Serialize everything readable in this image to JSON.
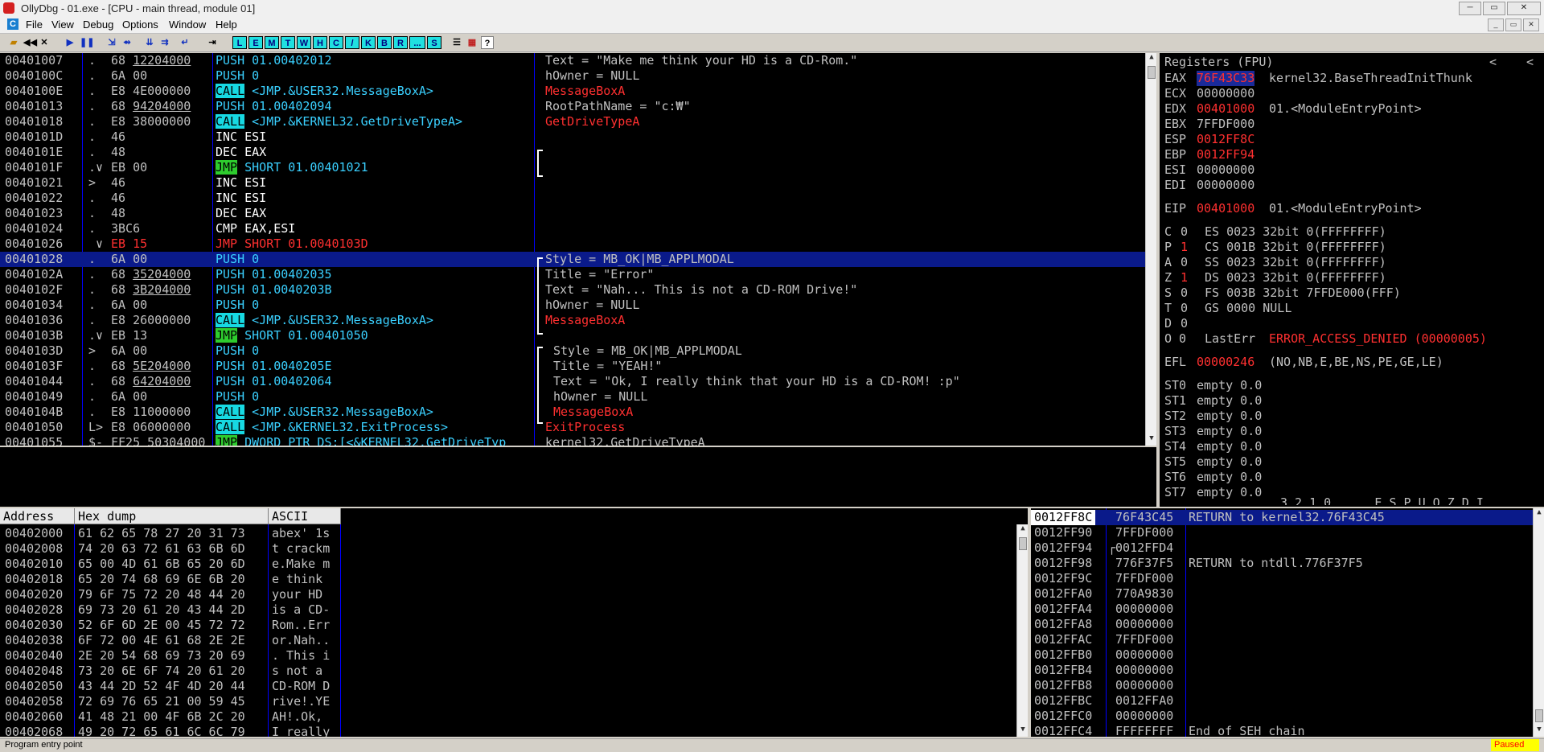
{
  "window": {
    "title": "OllyDbg - 01.exe - [CPU - main thread, module 01]",
    "min": "─",
    "max": "▭",
    "close": "✕"
  },
  "menu": [
    "File",
    "View",
    "Debug",
    "Options",
    "Window",
    "Help"
  ],
  "toolbar_letters": [
    "L",
    "E",
    "M",
    "T",
    "W",
    "H",
    "C",
    "/",
    "K",
    "B",
    "R",
    "...",
    "S"
  ],
  "disasm": [
    [
      "00401007",
      ".",
      "68 12204000",
      "PUSH 01.00402012",
      "Text = \"Make me think your HD is a CD-Rom.\""
    ],
    [
      "0040100C",
      ".",
      "6A 00",
      "PUSH 0",
      "hOwner = NULL"
    ],
    [
      "0040100E",
      ".",
      "E8 4E000000",
      "CALL <JMP.&USER32.MessageBoxA>",
      "MessageBoxA"
    ],
    [
      "00401013",
      ".",
      "68 94204000",
      "PUSH 01.00402094",
      "RootPathName = \"c:₩\""
    ],
    [
      "00401018",
      ".",
      "E8 38000000",
      "CALL <JMP.&KERNEL32.GetDriveTypeA>",
      "GetDriveTypeA"
    ],
    [
      "0040101D",
      ".",
      "46",
      "INC ESI",
      ""
    ],
    [
      "0040101E",
      ".",
      "48",
      "DEC EAX",
      ""
    ],
    [
      "0040101F",
      ".∨",
      "EB 00",
      "JMP SHORT 01.00401021",
      ""
    ],
    [
      "00401021",
      ">",
      "46",
      "INC ESI",
      ""
    ],
    [
      "00401022",
      ".",
      "46",
      "INC ESI",
      ""
    ],
    [
      "00401023",
      ".",
      "48",
      "DEC EAX",
      ""
    ],
    [
      "00401024",
      ".",
      "3BC6",
      "CMP EAX,ESI",
      ""
    ],
    [
      "00401026",
      " ∨",
      "EB 15",
      "JMP SHORT 01.0040103D",
      ""
    ],
    [
      "00401028",
      ".",
      "6A 00",
      "PUSH 0",
      "Style = MB_OK|MB_APPLMODAL"
    ],
    [
      "0040102A",
      ".",
      "68 35204000",
      "PUSH 01.00402035",
      "Title = \"Error\""
    ],
    [
      "0040102F",
      ".",
      "68 3B204000",
      "PUSH 01.0040203B",
      "Text = \"Nah... This is not a CD-ROM Drive!\""
    ],
    [
      "00401034",
      ".",
      "6A 00",
      "PUSH 0",
      "hOwner = NULL"
    ],
    [
      "00401036",
      ".",
      "E8 26000000",
      "CALL <JMP.&USER32.MessageBoxA>",
      "MessageBoxA"
    ],
    [
      "0040103B",
      ".∨",
      "EB 13",
      "JMP SHORT 01.00401050",
      ""
    ],
    [
      "0040103D",
      ">",
      "6A 00",
      "PUSH 0",
      "Style = MB_OK|MB_APPLMODAL"
    ],
    [
      "0040103F",
      ".",
      "68 5E204000",
      "PUSH 01.0040205E",
      "Title = \"YEAH!\""
    ],
    [
      "00401044",
      ".",
      "68 64204000",
      "PUSH 01.00402064",
      "Text = \"Ok, I really think that your HD is a CD-ROM! :p\""
    ],
    [
      "00401049",
      ".",
      "6A 00",
      "PUSH 0",
      "hOwner = NULL"
    ],
    [
      "0040104B",
      ".",
      "E8 11000000",
      "CALL <JMP.&USER32.MessageBoxA>",
      "MessageBoxA"
    ],
    [
      "00401050",
      "L>",
      "E8 06000000",
      "CALL <JMP.&KERNEL32.ExitProcess>",
      "ExitProcess"
    ],
    [
      "00401055",
      "$-",
      "FF25 50304000",
      "JMP DWORD PTR DS:[<&KERNEL32.GetDriveTyp",
      "kernel32.GetDriveTypeA"
    ]
  ],
  "registers": {
    "header": "Registers (FPU)",
    "nav_left": "<",
    "nav_right": "<",
    "gp": [
      [
        "EAX",
        "76F43C33",
        "kernel32.BaseThreadInitThunk"
      ],
      [
        "ECX",
        "00000000",
        ""
      ],
      [
        "EDX",
        "00401000",
        "01.<ModuleEntryPoint>"
      ],
      [
        "EBX",
        "7FFDF000",
        ""
      ],
      [
        "ESP",
        "0012FF8C",
        ""
      ],
      [
        "EBP",
        "0012FF94",
        ""
      ],
      [
        "ESI",
        "00000000",
        ""
      ],
      [
        "EDI",
        "00000000",
        ""
      ]
    ],
    "eip": [
      "EIP",
      "00401000",
      "01.<ModuleEntryPoint>"
    ],
    "flags": [
      [
        "C",
        "0",
        "ES 0023 32bit 0(FFFFFFFF)"
      ],
      [
        "P",
        "1",
        "CS 001B 32bit 0(FFFFFFFF)"
      ],
      [
        "A",
        "0",
        "SS 0023 32bit 0(FFFFFFFF)"
      ],
      [
        "Z",
        "1",
        "DS 0023 32bit 0(FFFFFFFF)"
      ],
      [
        "S",
        "0",
        "FS 003B 32bit 7FFDE000(FFF)"
      ],
      [
        "T",
        "0",
        "GS 0000 NULL"
      ],
      [
        "D",
        "0",
        ""
      ]
    ],
    "lasterr_flag": "O 0",
    "lasterr_label": "LastErr",
    "lasterr_value": "ERROR_ACCESS_DENIED (00000005)",
    "efl": [
      "EFL",
      "00000246",
      "(NO,NB,E,BE,NS,PE,GE,LE)"
    ],
    "fpu": [
      [
        "ST0",
        "empty 0.0"
      ],
      [
        "ST1",
        "empty 0.0"
      ],
      [
        "ST2",
        "empty 0.0"
      ],
      [
        "ST3",
        "empty 0.0"
      ],
      [
        "ST4",
        "empty 0.0"
      ],
      [
        "ST5",
        "empty 0.0"
      ],
      [
        "ST6",
        "empty 0.0"
      ],
      [
        "ST7",
        "empty 0.0"
      ]
    ],
    "fpu_tail": "3 2 1 0      E S P U O Z D I"
  },
  "dump": {
    "headers": [
      "Address",
      "Hex dump",
      "ASCII"
    ],
    "rows": [
      [
        "00402000",
        "61 62 65 78 27 20 31 73",
        "abex' 1s"
      ],
      [
        "00402008",
        "74 20 63 72 61 63 6B 6D",
        "t crackm"
      ],
      [
        "00402010",
        "65 00 4D 61 6B 65 20 6D",
        "e.Make m"
      ],
      [
        "00402018",
        "65 20 74 68 69 6E 6B 20",
        "e think "
      ],
      [
        "00402020",
        "79 6F 75 72 20 48 44 20",
        "your HD "
      ],
      [
        "00402028",
        "69 73 20 61 20 43 44 2D",
        "is a CD-"
      ],
      [
        "00402030",
        "52 6F 6D 2E 00 45 72 72",
        "Rom..Err"
      ],
      [
        "00402038",
        "6F 72 00 4E 61 68 2E 2E",
        "or.Nah.."
      ],
      [
        "00402040",
        "2E 20 54 68 69 73 20 69",
        ". This i"
      ],
      [
        "00402048",
        "73 20 6E 6F 74 20 61 20",
        "s not a "
      ],
      [
        "00402050",
        "43 44 2D 52 4F 4D 20 44",
        "CD-ROM D"
      ],
      [
        "00402058",
        "72 69 76 65 21 00 59 45",
        "rive!.YE"
      ],
      [
        "00402060",
        "41 48 21 00 4F 6B 2C 20",
        "AH!.Ok, "
      ],
      [
        "00402068",
        "49 20 72 65 61 6C 6C 79",
        "I really"
      ]
    ]
  },
  "stack": [
    [
      "0012FF8C",
      "76F43C45",
      "RETURN to kernel32.76F43C45"
    ],
    [
      "0012FF90",
      "7FFDF000",
      ""
    ],
    [
      "0012FF94",
      "0012FFD4",
      ""
    ],
    [
      "0012FF98",
      "776F37F5",
      "RETURN to ntdll.776F37F5"
    ],
    [
      "0012FF9C",
      "7FFDF000",
      ""
    ],
    [
      "0012FFA0",
      "770A9830",
      ""
    ],
    [
      "0012FFA4",
      "00000000",
      ""
    ],
    [
      "0012FFA8",
      "00000000",
      ""
    ],
    [
      "0012FFAC",
      "7FFDF000",
      ""
    ],
    [
      "0012FFB0",
      "00000000",
      ""
    ],
    [
      "0012FFB4",
      "00000000",
      ""
    ],
    [
      "0012FFB8",
      "00000000",
      ""
    ],
    [
      "0012FFBC",
      "0012FFA0",
      ""
    ],
    [
      "0012FFC0",
      "00000000",
      ""
    ],
    [
      "0012FFC4",
      "FFFFFFFF",
      "End of SEH chain"
    ]
  ],
  "status": {
    "text": "Program entry point",
    "state": "Paused"
  }
}
